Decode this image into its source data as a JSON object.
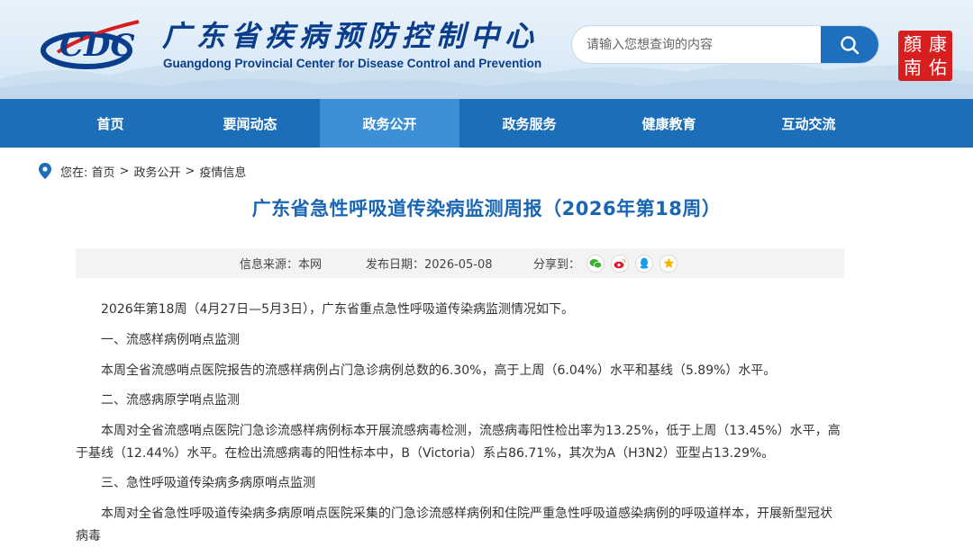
{
  "header": {
    "logo_cn": "广东省疾病预防控制中心",
    "logo_en": "Guangdong Provincial Center for Disease Control and Prevention",
    "search_placeholder": "请输入您想查询的内容",
    "seal_chars": [
      "康",
      "顏",
      "佑",
      "南"
    ]
  },
  "nav": {
    "items": [
      {
        "label": "首页"
      },
      {
        "label": "要闻动态"
      },
      {
        "label": "政务公开"
      },
      {
        "label": "政务服务"
      },
      {
        "label": "健康教育"
      },
      {
        "label": "互动交流"
      }
    ],
    "active_index": 2
  },
  "breadcrumb": {
    "prefix": "您在:",
    "items": [
      "首页",
      "政务公开",
      "疫情信息"
    ],
    "separator": ">"
  },
  "article": {
    "title": "广东省急性呼吸道传染病监测周报（2026年第18周）",
    "source": "信息来源：本网",
    "date": "发布日期：2026-05-08",
    "share_label": "分享到：",
    "paragraphs": [
      "2026年第18周（4月27日—5月3日），广东省重点急性呼吸道传染病监测情况如下。",
      "一、流感样病例哨点监测",
      "本周全省流感哨点医院报告的流感样病例占门急诊病例总数的6.30%，高于上周（6.04%）水平和基线（5.89%）水平。",
      "二、流感病原学哨点监测",
      "本周对全省流感哨点医院门急诊流感样病例标本开展流感病毒检测，流感病毒阳性检出率为13.25%，低于上周（13.45%）水平，高于基线（12.44%）水平。在检出流感病毒的阳性标本中，B（Victoria）系占86.71%，其次为A（H3N2）亚型占13.29%。",
      "三、急性呼吸道传染病多病原哨点监测",
      "本周对全省急性呼吸道传染病多病原哨点医院采集的门急诊流感样病例和住院严重急性呼吸道感染病例的呼吸道样本，开展新型冠状病毒"
    ]
  },
  "colors": {
    "brand_blue": "#1c6eb9",
    "nav_active": "#3d8fd6",
    "title_blue": "#1a66b3",
    "seal_red": "#d81f1f"
  }
}
